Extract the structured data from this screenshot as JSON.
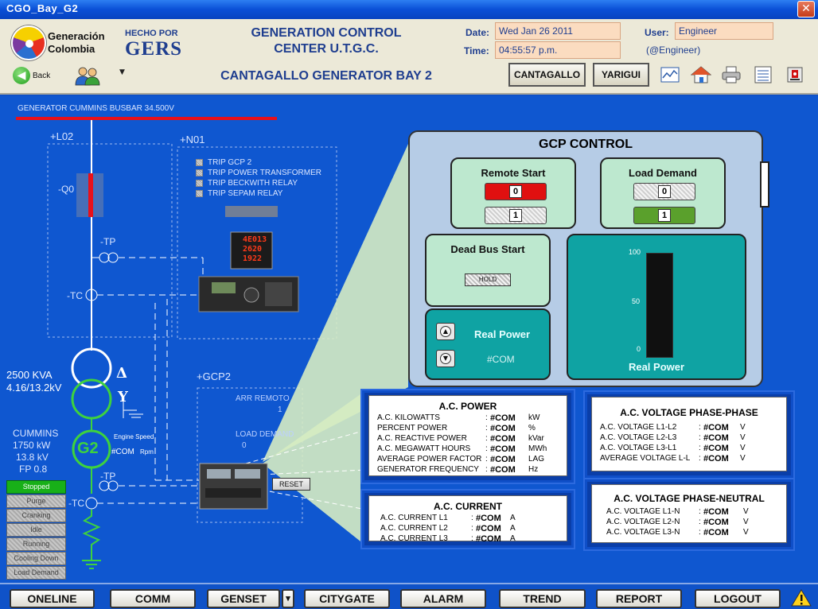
{
  "window": {
    "title": "CGO_Bay_G2",
    "close": "✕"
  },
  "header": {
    "brand_line1": "Generación",
    "brand_line2": "Colombia",
    "hecho": "HECHO POR",
    "gers": "GERS",
    "title_line1": "GENERATION CONTROL",
    "title_line2": "CENTER U.T.G.C.",
    "subtitle": "CANTAGALLO GENERATOR BAY 2",
    "date_label": "Date:",
    "date_value": "Wed Jan 26 2011",
    "time_label": "Time:",
    "time_value": "04:55:57 p.m.",
    "user_label": "User:",
    "user_value": "Engineer",
    "user_at": "(@Engineer)",
    "back_label": "Back",
    "btn_cantagallo": "CANTAGALLO",
    "btn_yarigui": "YARIGUI"
  },
  "schematic": {
    "busbar_label": "GENERATOR CUMMINS BUSBAR 34.500V",
    "l02": "+L02",
    "n01": "+N01",
    "q0": "-Q0",
    "tp1": "-TP",
    "tc1": "-TC",
    "transformer_kva": "2500 KVA",
    "transformer_kv": "4.16/13.2kV",
    "delta": "Δ",
    "wye": "Y",
    "gcp2": "+GCP2",
    "arr_remoto": "ARR REMOTO",
    "arr_remoto_val": "1",
    "load_demand": "LOAD DEMAND",
    "load_demand_val": "0",
    "cummins": "CUMMINS",
    "kw": "1750 kW",
    "kv": "13.8 kV",
    "fp": "FP 0.8",
    "g2": "G2",
    "engine_speed": "Engine Speed",
    "engine_com": "#COM",
    "rpm": "Rpm",
    "tp2": "-TP",
    "tc2": "-TC",
    "reset": "RESET",
    "trips": [
      "TRIP GCP 2",
      "TRIP POWER TRANSFORMER",
      "TRIP BECKWITH RELAY",
      "TRIP SEPAM RELAY"
    ],
    "status": [
      "Stopped",
      "Purge",
      "Cranking",
      "Idle",
      "Running",
      "Cooling Down",
      "Load Demand"
    ],
    "relay_display": [
      "4E013",
      "2620",
      "1922"
    ]
  },
  "gcp": {
    "title": "GCP CONTROL",
    "remote_start": "Remote Start",
    "rs_0": "0",
    "rs_1": "1",
    "load_demand": "Load Demand",
    "ld_0": "0",
    "ld_1": "1",
    "dead_bus": "Dead Bus Start",
    "hold": "HOLD",
    "real_power": "Real Power",
    "real_power_val": "#COM",
    "bar_label": "Real Power",
    "ticks": [
      "100",
      "50",
      "0"
    ],
    "bar_level": 0
  },
  "panels": {
    "ac_power": {
      "title": "A.C. POWER",
      "rows": [
        {
          "name": "A.C. KILOWATTS",
          "value": "#COM",
          "unit": "kW"
        },
        {
          "name": "PERCENT POWER",
          "value": "#COM",
          "unit": "%"
        },
        {
          "name": "A.C. REACTIVE POWER",
          "value": "#COM",
          "unit": "kVar"
        },
        {
          "name": "A.C. MEGAWATT HOURS",
          "value": "#COM",
          "unit": "MWh"
        },
        {
          "name": "AVERAGE POWER FACTOR",
          "value": "#COM",
          "unit": "LAG"
        },
        {
          "name": "GENERATOR FREQUENCY",
          "value": "#COM",
          "unit": "Hz"
        }
      ]
    },
    "ac_current": {
      "title": "A.C. CURRENT",
      "rows": [
        {
          "name": "A.C. CURRENT L1",
          "value": "#COM",
          "unit": "A"
        },
        {
          "name": "A.C. CURRENT L2",
          "value": "#COM",
          "unit": "A"
        },
        {
          "name": "A.C. CURRENT L3",
          "value": "#COM",
          "unit": "A"
        }
      ]
    },
    "vpp": {
      "title": "A.C. VOLTAGE PHASE-PHASE",
      "rows": [
        {
          "name": "A.C. VOLTAGE L1-L2",
          "value": "#COM",
          "unit": "V"
        },
        {
          "name": "A.C. VOLTAGE L2-L3",
          "value": "#COM",
          "unit": "V"
        },
        {
          "name": "A.C. VOLTAGE L3-L1",
          "value": "#COM",
          "unit": "V"
        },
        {
          "name": "AVERAGE VOLTAGE L-L",
          "value": "#COM",
          "unit": "V"
        }
      ]
    },
    "vpn": {
      "title": "A.C. VOLTAGE PHASE-NEUTRAL",
      "rows": [
        {
          "name": "A.C. VOLTAGE L1-N",
          "value": "#COM",
          "unit": "V"
        },
        {
          "name": "A.C. VOLTAGE L2-N",
          "value": "#COM",
          "unit": "V"
        },
        {
          "name": "A.C. VOLTAGE L3-N",
          "value": "#COM",
          "unit": "V"
        }
      ]
    }
  },
  "nav": {
    "oneline": "ONELINE",
    "comm": "COMM",
    "genset": "GENSET",
    "genset_dd": "▾",
    "citygate": "CITYGATE",
    "alarm": "ALARM",
    "trend": "TREND",
    "report": "REPORT",
    "logout": "LOGOUT"
  },
  "colors": {
    "background": "#0f57d0",
    "busbar": "#e8101a",
    "generator": "#3ed23e",
    "panel": "#b6cce6"
  }
}
